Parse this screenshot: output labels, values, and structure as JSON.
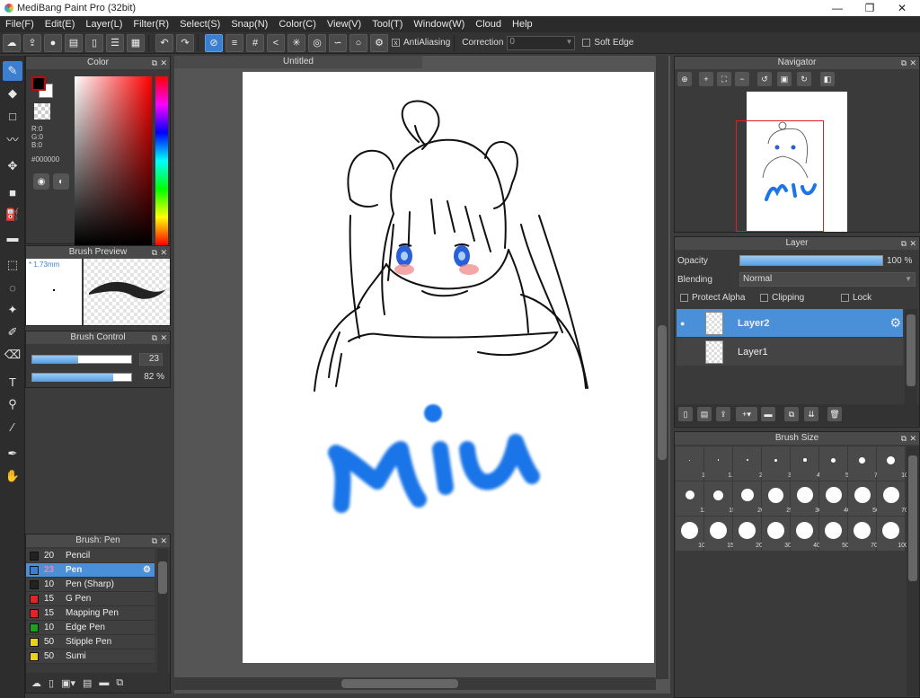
{
  "app": {
    "title": "MediBang Paint Pro (32bit)",
    "minimize": "—",
    "maximize": "❐",
    "close": "✕"
  },
  "menu": [
    "File(F)",
    "Edit(E)",
    "Layer(L)",
    "Filter(R)",
    "Select(S)",
    "Snap(N)",
    "Color(C)",
    "View(V)",
    "Tool(T)",
    "Window(W)",
    "Cloud",
    "Help"
  ],
  "toolbar": {
    "antialias_label": "AntiAliasing",
    "correction_label": "Correction",
    "correction_value": "0",
    "softedge_label": "Soft Edge",
    "antialias_checked": "x"
  },
  "color_panel": {
    "title": "Color",
    "r": "R:0",
    "g": "G:0",
    "b": "B:0",
    "hex": "#000000"
  },
  "brush_preview": {
    "title": "Brush Preview",
    "size": "* 1.73mm"
  },
  "brush_control": {
    "title": "Brush Control",
    "size_value": "23",
    "size_fraction": 0.46,
    "opacity_value": "82 %",
    "opacity_fraction": 0.82
  },
  "brush_list": {
    "title": "Brush: Pen",
    "items": [
      {
        "size": "20",
        "name": "Pencil",
        "color": "#222222"
      },
      {
        "size": "23",
        "name": "Pen",
        "color": "#3b7fd1"
      },
      {
        "size": "10",
        "name": "Pen (Sharp)",
        "color": "#222222"
      },
      {
        "size": "15",
        "name": "G Pen",
        "color": "#e32424"
      },
      {
        "size": "15",
        "name": "Mapping Pen",
        "color": "#e32424"
      },
      {
        "size": "10",
        "name": "Edge Pen",
        "color": "#1ea01e"
      },
      {
        "size": "50",
        "name": "Stipple Pen",
        "color": "#e6d21e"
      },
      {
        "size": "50",
        "name": "Sumi",
        "color": "#e6d21e"
      }
    ],
    "selected_index": 1
  },
  "document": {
    "tab": "Untitled",
    "drawing_text": "Miu",
    "text_color": "#1a75e8"
  },
  "navigator": {
    "title": "Navigator"
  },
  "layer_panel": {
    "title": "Layer",
    "opacity_label": "Opacity",
    "opacity_value": "100 %",
    "opacity_fraction": 1.0,
    "blending_label": "Blending",
    "blending_value": "Normal",
    "protect_alpha": "Protect Alpha",
    "clipping": "Clipping",
    "lock": "Lock",
    "layers": [
      "Layer2",
      "Layer1"
    ]
  },
  "brush_size": {
    "title": "Brush Size",
    "sizes": [
      "1",
      "1.5",
      "2",
      "3",
      "4",
      "5",
      "7",
      "10",
      "12",
      "15",
      "20",
      "25",
      "30",
      "40",
      "50",
      "70",
      "100",
      "150",
      "200",
      "300",
      "400",
      "500",
      "700",
      "1000"
    ]
  }
}
